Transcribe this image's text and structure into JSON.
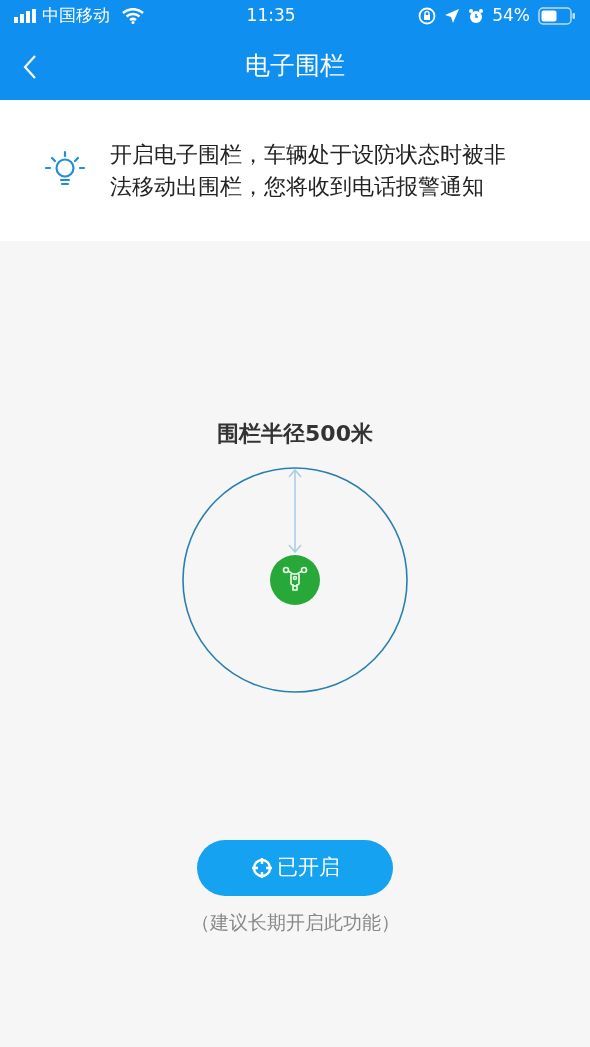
{
  "status_bar": {
    "carrier": "中国移动",
    "time": "11:35",
    "battery": "54%"
  },
  "nav": {
    "title": "电子围栏"
  },
  "tip": {
    "text": "开启电子围栏，车辆处于设防状态时被非法移动出围栏，您将收到电话报警通知"
  },
  "fence": {
    "radius_label": "围栏半径500米"
  },
  "toggle": {
    "label": "已开启",
    "on": true
  },
  "hint": "（建议长期开启此功能）"
}
